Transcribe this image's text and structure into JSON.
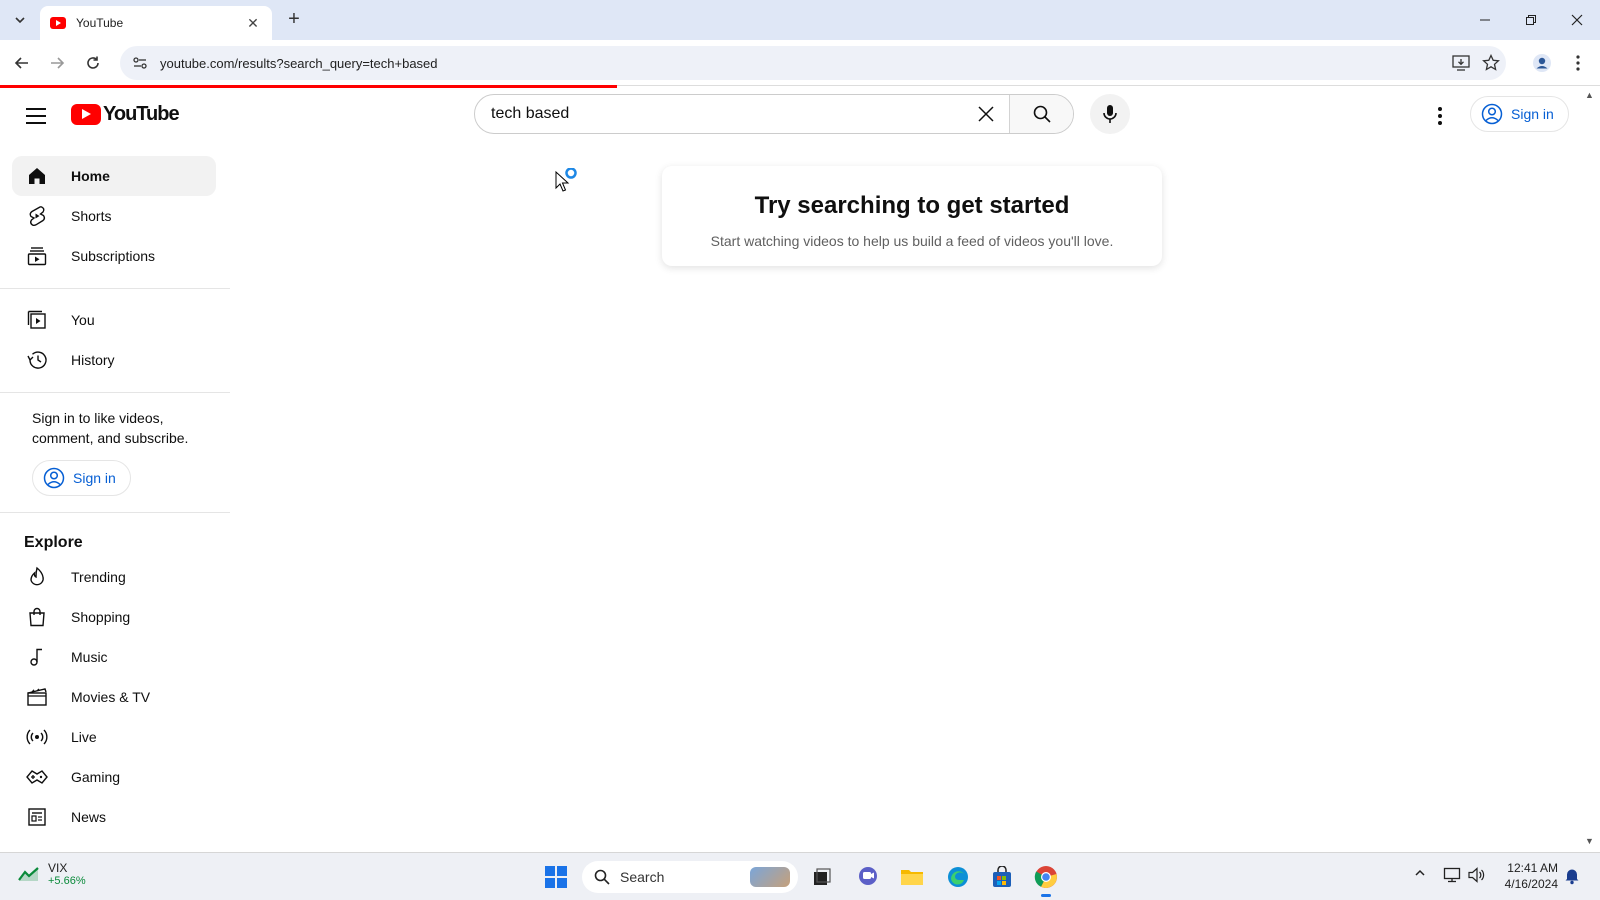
{
  "browser": {
    "tab_title": "YouTube",
    "url": "youtube.com/results?search_query=tech+based"
  },
  "masthead": {
    "logo_text": "YouTube",
    "search_value": "tech based",
    "signin_label": "Sign in"
  },
  "sidebar": {
    "primary": [
      {
        "label": "Home",
        "icon": "home-icon"
      },
      {
        "label": "Shorts",
        "icon": "shorts-icon"
      },
      {
        "label": "Subscriptions",
        "icon": "subscriptions-icon"
      }
    ],
    "you": [
      {
        "label": "You",
        "icon": "you-icon"
      },
      {
        "label": "History",
        "icon": "history-icon"
      }
    ],
    "signin_prompt": "Sign in to like videos, comment, and subscribe.",
    "signin_label": "Sign in",
    "explore_title": "Explore",
    "explore": [
      {
        "label": "Trending",
        "icon": "trending-icon"
      },
      {
        "label": "Shopping",
        "icon": "shopping-icon"
      },
      {
        "label": "Music",
        "icon": "music-icon"
      },
      {
        "label": "Movies & TV",
        "icon": "movies-icon"
      },
      {
        "label": "Live",
        "icon": "live-icon"
      },
      {
        "label": "Gaming",
        "icon": "gaming-icon"
      },
      {
        "label": "News",
        "icon": "news-icon"
      }
    ]
  },
  "main": {
    "card_title": "Try searching to get started",
    "card_subtitle": "Start watching videos to help us build a feed of videos you'll love."
  },
  "taskbar": {
    "widget_name": "VIX",
    "widget_value": "+5.66%",
    "search_placeholder": "Search",
    "time": "12:41 AM",
    "date": "4/16/2024"
  },
  "colors": {
    "brand_red": "#ff0000",
    "link_blue": "#065fd4"
  }
}
